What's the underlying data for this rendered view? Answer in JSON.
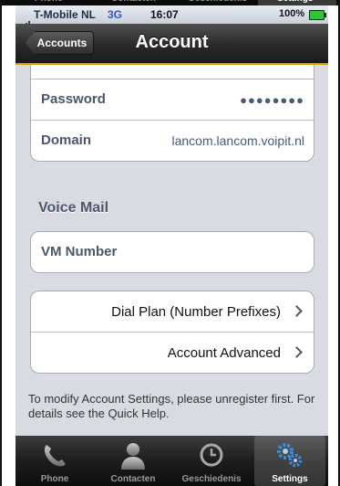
{
  "status_bar": {
    "carrier": "T-Mobile NL",
    "network": "3G",
    "time": "16:07",
    "battery": "100%"
  },
  "nav": {
    "back_label": "Accounts",
    "title": "Account"
  },
  "account_fields": {
    "password_label": "Password",
    "password_value": "●●●●●●●●",
    "domain_label": "Domain",
    "domain_value": "lancom.lancom.voipit.nl"
  },
  "voice_mail": {
    "header": "Voice Mail",
    "vm_number_label": "VM Number"
  },
  "actions": {
    "dial_plan": "Dial Plan (Number Prefixes)",
    "account_advanced": "Account Advanced"
  },
  "note": "To modify Account Settings, please unregister first.  For details see the Quick Help.",
  "tabs": [
    {
      "label": "Phone",
      "icon": "phone-icon",
      "selected": false
    },
    {
      "label": "Contacten",
      "icon": "contacts-icon",
      "selected": false
    },
    {
      "label": "Geschiedenis",
      "icon": "clock-icon",
      "selected": false
    },
    {
      "label": "Settings",
      "icon": "gears-icon",
      "selected": true
    }
  ],
  "colors": {
    "nav_accent": "#d9a200",
    "network_blue": "#3558c6",
    "battery_green": "#31c43a"
  }
}
